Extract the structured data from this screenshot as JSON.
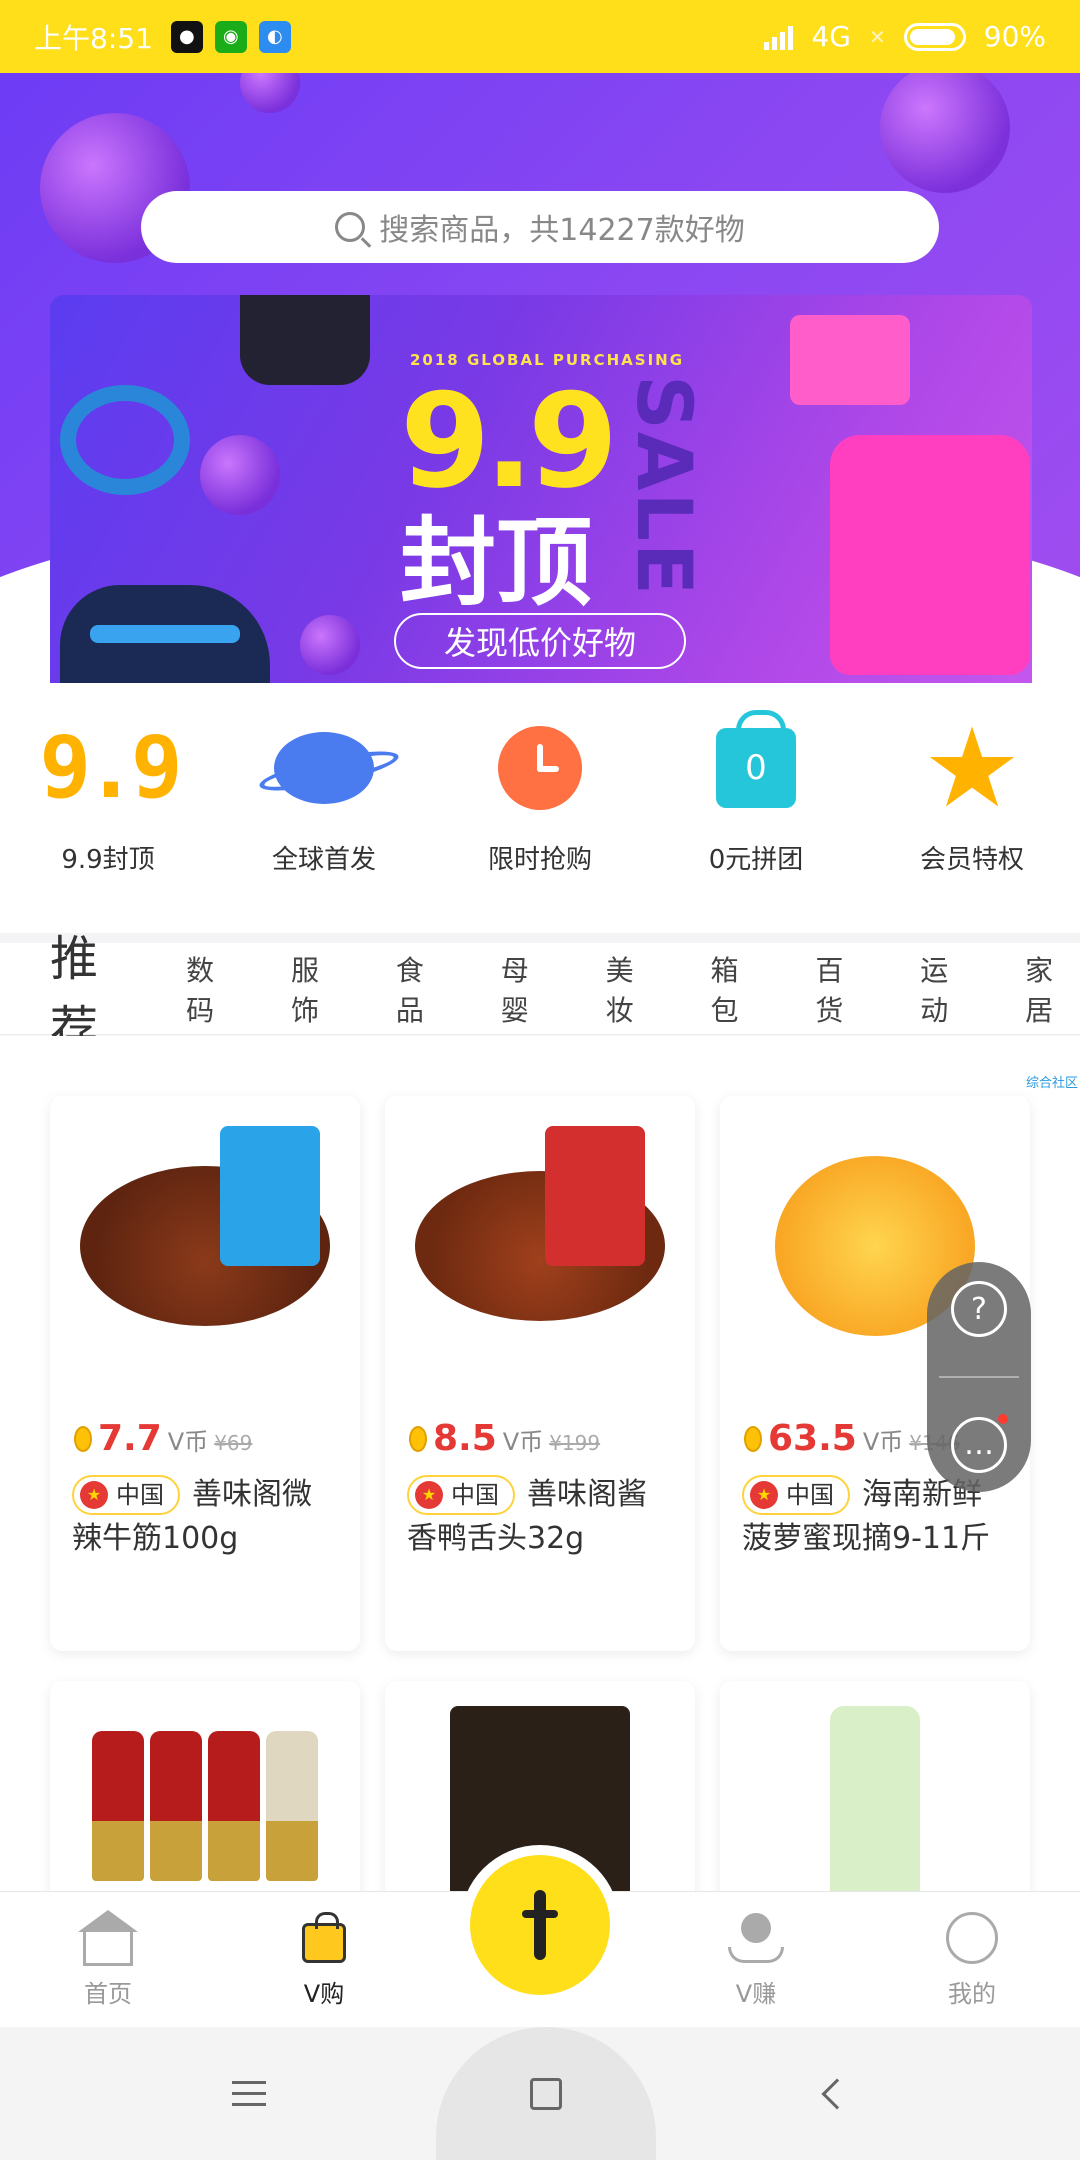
{
  "status_bar": {
    "time": "上午8:51",
    "network": "4G",
    "battery": "90%"
  },
  "search": {
    "placeholder": "搜索商品，共14227款好物"
  },
  "banner": {
    "subtitle": "2018 GLOBAL PURCHASING",
    "headline": "9.9",
    "caption": "封顶",
    "side_text": "SALE",
    "button": "发现低价好物"
  },
  "quick_nav": [
    {
      "label": "9.9封顶",
      "icon": "nine-nine-icon"
    },
    {
      "label": "全球首发",
      "icon": "planet-icon"
    },
    {
      "label": "限时抢购",
      "icon": "alarm-clock-icon"
    },
    {
      "label": "0元拼团",
      "icon": "zero-bag-icon",
      "badge": "0"
    },
    {
      "label": "会员特权",
      "icon": "star-icon"
    }
  ],
  "tabs": [
    "推荐",
    "数码",
    "服饰",
    "食品",
    "母婴",
    "美妆",
    "箱包",
    "百货",
    "运动",
    "家居"
  ],
  "community_tag": "综合社区",
  "products": [
    {
      "price": "7.7",
      "unit": "V币",
      "original": "¥69",
      "origin": "中国",
      "title": "善味阁微辣牛筋100g"
    },
    {
      "price": "8.5",
      "unit": "V币",
      "original": "¥199",
      "origin": "中国",
      "title": "善味阁酱香鸭舌头32g"
    },
    {
      "price": "63.5",
      "unit": "V币",
      "original": "¥146",
      "origin": "中国",
      "title": "海南新鲜菠萝蜜现摘9-11斤"
    }
  ],
  "float_panel": {
    "help": "?",
    "chat": "chat-bubble-icon"
  },
  "bottom_nav": [
    {
      "label": "首页",
      "icon": "home-icon",
      "active": false
    },
    {
      "label": "V购",
      "icon": "shopping-bag-icon",
      "active": true
    },
    {
      "label": "",
      "icon": "plus-fab-icon",
      "active": false
    },
    {
      "label": "V赚",
      "icon": "earn-hand-icon",
      "active": false
    },
    {
      "label": "我的",
      "icon": "profile-icon",
      "active": false
    }
  ],
  "colors": {
    "brand_yellow": "#ffde1a",
    "hero_purple": "#7a3ae6",
    "price_red": "#e53935",
    "tab_underline": "#ff4a6a"
  }
}
